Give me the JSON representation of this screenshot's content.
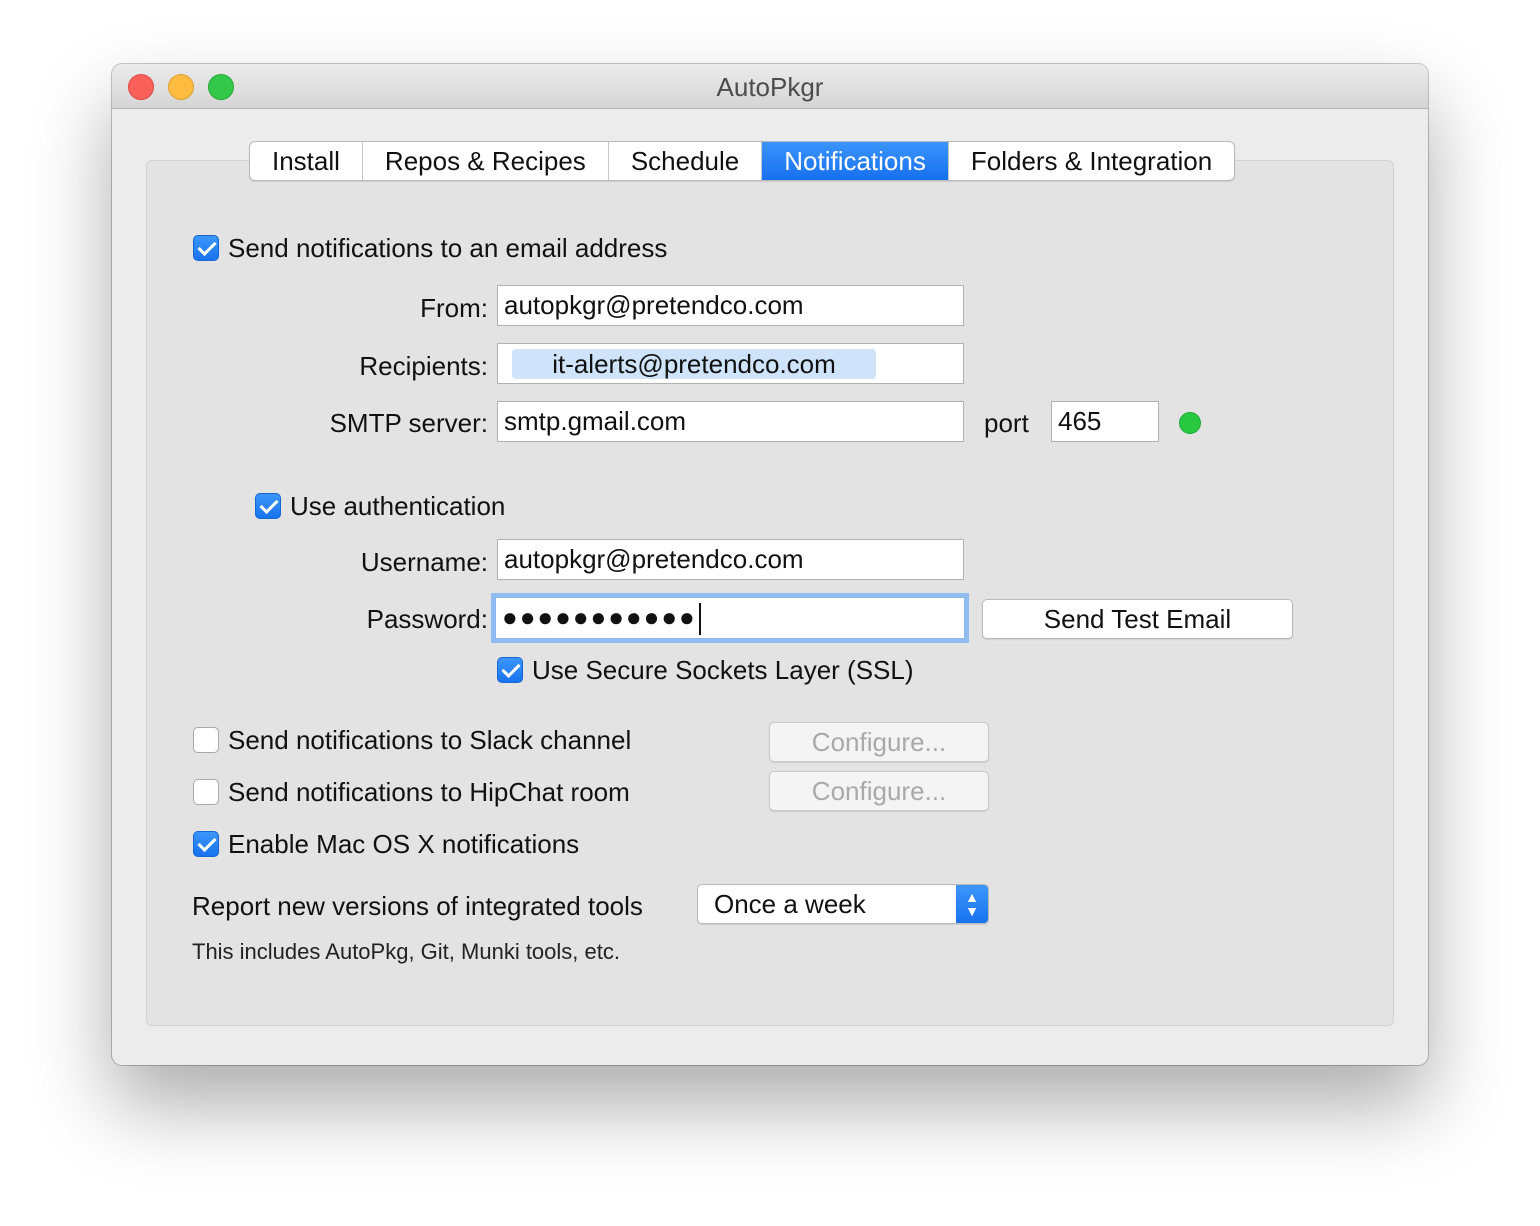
{
  "window": {
    "title": "AutoPkgr"
  },
  "tabs": [
    {
      "label": "Install"
    },
    {
      "label": "Repos & Recipes"
    },
    {
      "label": "Schedule"
    },
    {
      "label": "Notifications"
    },
    {
      "label": "Folders & Integration"
    }
  ],
  "active_tab": "Notifications",
  "email": {
    "enabled_label": "Send notifications to an email address",
    "enabled": true,
    "from_label": "From:",
    "from_value": "autopkgr@pretendco.com",
    "recipients_label": "Recipients:",
    "recipients": [
      "it-alerts@pretendco.com"
    ],
    "smtp_label": "SMTP server:",
    "smtp_value": "smtp.gmail.com",
    "port_label": "port",
    "port_value": "465",
    "server_status_color": "#28c940"
  },
  "auth": {
    "use_auth_label": "Use authentication",
    "use_auth": true,
    "username_label": "Username:",
    "username_value": "autopkgr@pretendco.com",
    "password_label": "Password:",
    "password_masked": "●●●●●●●●●●●",
    "send_test_label": "Send Test Email",
    "ssl_label": "Use Secure Sockets Layer (SSL)",
    "ssl": true
  },
  "slack": {
    "label": "Send notifications to Slack channel",
    "enabled": false,
    "configure_label": "Configure..."
  },
  "hipchat": {
    "label": "Send notifications to HipChat room",
    "enabled": false,
    "configure_label": "Configure..."
  },
  "macos": {
    "label": "Enable Mac OS X notifications",
    "enabled": true
  },
  "report": {
    "label": "Report new versions of integrated tools",
    "selected": "Once a week",
    "note": "This includes AutoPkg, Git, Munki tools, etc."
  },
  "colors": {
    "accent": "#1770ee",
    "window_bg": "#ececec"
  }
}
